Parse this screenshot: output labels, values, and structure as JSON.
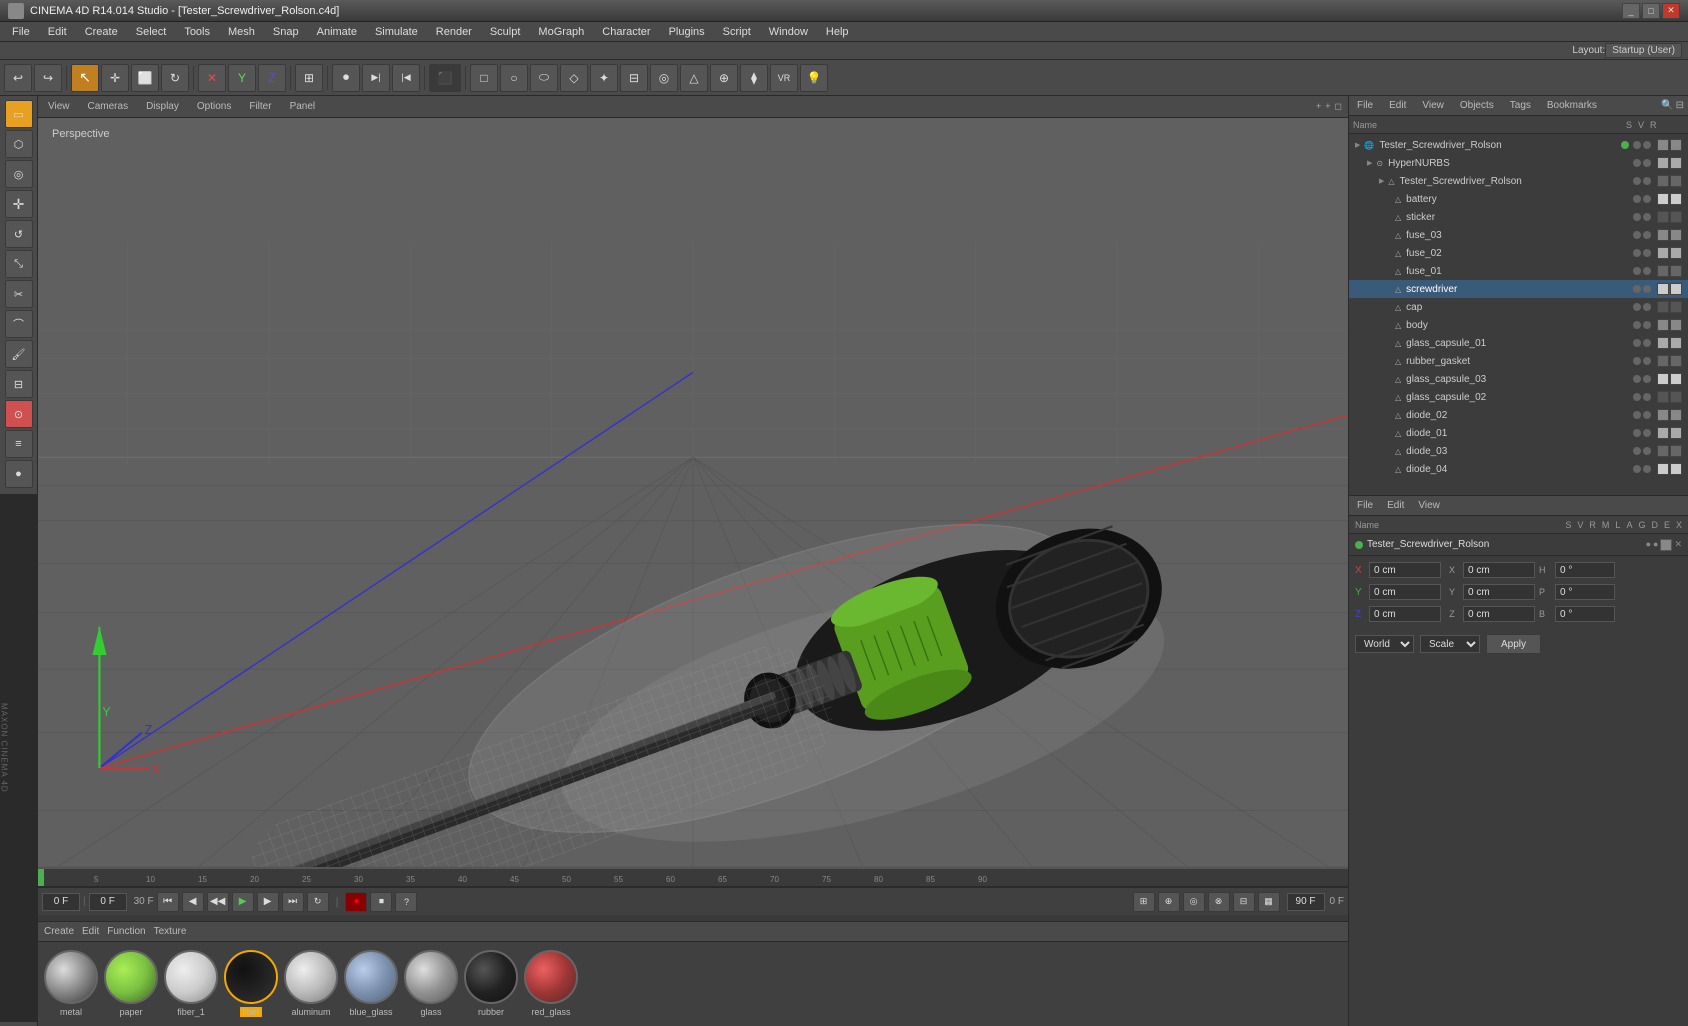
{
  "titleBar": {
    "title": "CINEMA 4D R14.014 Studio - [Tester_Screwdriver_Rolson.c4d]",
    "icon": "cinema4d-icon"
  },
  "menuBar": {
    "items": [
      "File",
      "Edit",
      "Create",
      "Select",
      "Tools",
      "Mesh",
      "Snap",
      "Animate",
      "Simulate",
      "Render",
      "Sculpt",
      "MoGraph",
      "Character",
      "Plugins",
      "Script",
      "Window",
      "Help"
    ]
  },
  "layoutBar": {
    "label": "Layout:",
    "value": "Startup (User)"
  },
  "toolbar": {
    "buttons": [
      {
        "icon": "undo",
        "label": "↩"
      },
      {
        "icon": "redo",
        "label": "↪"
      },
      {
        "icon": "select-arrow",
        "label": "↖"
      },
      {
        "icon": "move",
        "label": "✛"
      },
      {
        "icon": "scale",
        "label": "⬜"
      },
      {
        "icon": "rotate",
        "label": "↻"
      },
      {
        "icon": "toggle",
        "label": "✕"
      },
      {
        "icon": "y-axis",
        "label": "Y"
      },
      {
        "icon": "z-axis",
        "label": "Z"
      },
      {
        "icon": "snap",
        "label": "⊞"
      },
      {
        "icon": "film",
        "label": "🎬"
      },
      {
        "icon": "anim1",
        "label": "⏯"
      },
      {
        "icon": "anim2",
        "label": "⏭"
      },
      {
        "icon": "render",
        "label": "⬛"
      },
      {
        "icon": "viewport-cube",
        "label": "□"
      },
      {
        "icon": "nurbs",
        "label": "○"
      },
      {
        "icon": "sweep",
        "label": "◇"
      },
      {
        "icon": "extrude",
        "label": "△"
      },
      {
        "icon": "boole",
        "label": "⊕"
      },
      {
        "icon": "camera",
        "label": "📷"
      },
      {
        "icon": "light",
        "label": "💡"
      }
    ]
  },
  "leftSidebar": {
    "buttons": [
      {
        "icon": "select-rect",
        "label": "▭",
        "active": true
      },
      {
        "icon": "select-poly",
        "label": "⬡"
      },
      {
        "icon": "select-live",
        "label": "◎"
      },
      {
        "icon": "move-tool",
        "label": "✛"
      },
      {
        "icon": "rotate-tool",
        "label": "↺"
      },
      {
        "icon": "scale-tool",
        "label": "⤡"
      },
      {
        "icon": "knife",
        "label": "✂"
      },
      {
        "icon": "bridge",
        "label": "⌒"
      },
      {
        "icon": "paint",
        "label": "🖌"
      },
      {
        "icon": "measure",
        "label": "📏"
      },
      {
        "icon": "magnet",
        "label": "⊙"
      },
      {
        "icon": "layer",
        "label": "≡"
      },
      {
        "icon": "sphere-tool",
        "label": "●"
      }
    ]
  },
  "viewport": {
    "perspectiveLabel": "Perspective",
    "tabs": [
      "View",
      "Cameras",
      "Display",
      "Options",
      "Filter",
      "Panel"
    ],
    "cornerButtons": [
      "+",
      "+",
      "◻"
    ]
  },
  "sceneTree": {
    "title": "Tester_Screwdriver_Rolson",
    "items": [
      {
        "name": "Tester_Screwdriver_Rolson",
        "level": 0,
        "type": "scene",
        "hasGreen": true
      },
      {
        "name": "HyperNURBS",
        "level": 1,
        "type": "nurbs"
      },
      {
        "name": "Tester_Screwdriver_Rolson",
        "level": 2,
        "type": "object"
      },
      {
        "name": "battery",
        "level": 3,
        "type": "mesh"
      },
      {
        "name": "sticker",
        "level": 3,
        "type": "mesh"
      },
      {
        "name": "fuse_03",
        "level": 3,
        "type": "mesh"
      },
      {
        "name": "fuse_02",
        "level": 3,
        "type": "mesh"
      },
      {
        "name": "fuse_01",
        "level": 3,
        "type": "mesh"
      },
      {
        "name": "screwdriver",
        "level": 3,
        "type": "mesh",
        "selected": true
      },
      {
        "name": "cap",
        "level": 3,
        "type": "mesh"
      },
      {
        "name": "body",
        "level": 3,
        "type": "mesh"
      },
      {
        "name": "glass_capsule_01",
        "level": 3,
        "type": "mesh"
      },
      {
        "name": "rubber_gasket",
        "level": 3,
        "type": "mesh"
      },
      {
        "name": "glass_capsule_03",
        "level": 3,
        "type": "mesh"
      },
      {
        "name": "glass_capsule_02",
        "level": 3,
        "type": "mesh"
      },
      {
        "name": "diode_02",
        "level": 3,
        "type": "mesh"
      },
      {
        "name": "diode_01",
        "level": 3,
        "type": "mesh"
      },
      {
        "name": "diode_03",
        "level": 3,
        "type": "mesh"
      },
      {
        "name": "diode_04",
        "level": 3,
        "type": "mesh"
      }
    ]
  },
  "rightTopTabs": [
    "File",
    "Edit",
    "View",
    "Objects",
    "Tags",
    "Bookmarks"
  ],
  "rightBottomTabs": [
    "Name",
    "S",
    "V",
    "R",
    "M",
    "L",
    "A",
    "G",
    "D",
    "E",
    "X"
  ],
  "attrPanel": {
    "selectedName": "Tester_Screwdriver_Rolson",
    "coords": {
      "x": {
        "pos": "0 cm",
        "label": "X"
      },
      "y": {
        "pos": "0 cm",
        "label": "Y"
      },
      "z": {
        "pos": "0 cm",
        "label": "Z"
      },
      "xSize": "0 cm",
      "ySize": "0 cm",
      "zSize": "0 cm",
      "rH": "0 °",
      "rP": "0 °",
      "rB": "0 °"
    },
    "coordMode": "World",
    "transformMode": "Scale",
    "applyLabel": "Apply"
  },
  "timeline": {
    "startFrame": "0 F",
    "endFrame": "90 F",
    "currentFrame": "0 F",
    "previewStart": "0 F",
    "previewEnd": "90 F",
    "fps": "30 F"
  },
  "materials": {
    "items": [
      {
        "name": "metal",
        "sphereColor": "#888",
        "sphereGradient": "metal",
        "selected": false
      },
      {
        "name": "paper",
        "sphereColor": "#7bc043",
        "sphereGradient": "paper",
        "selected": false
      },
      {
        "name": "fiber_1",
        "sphereColor": "#ccc",
        "sphereGradient": "fiber",
        "selected": false
      },
      {
        "name": "fiber",
        "sphereColor": "#e8a020",
        "sphereGradient": "fiber",
        "selected": true
      },
      {
        "name": "aluminum",
        "sphereColor": "#aaa",
        "sphereGradient": "aluminum",
        "selected": false
      },
      {
        "name": "blue_glass",
        "sphereColor": "#c8c8d8",
        "sphereGradient": "glass",
        "selected": false
      },
      {
        "name": "glass",
        "sphereColor": "#ddd",
        "sphereGradient": "glass",
        "selected": false
      },
      {
        "name": "rubber",
        "sphereColor": "#222",
        "sphereGradient": "rubber",
        "selected": false
      },
      {
        "name": "red_glass",
        "sphereColor": "#cc3333",
        "sphereGradient": "red_glass",
        "selected": false
      }
    ]
  },
  "maxon": {
    "label": "MAXON CINEMA 4D"
  }
}
